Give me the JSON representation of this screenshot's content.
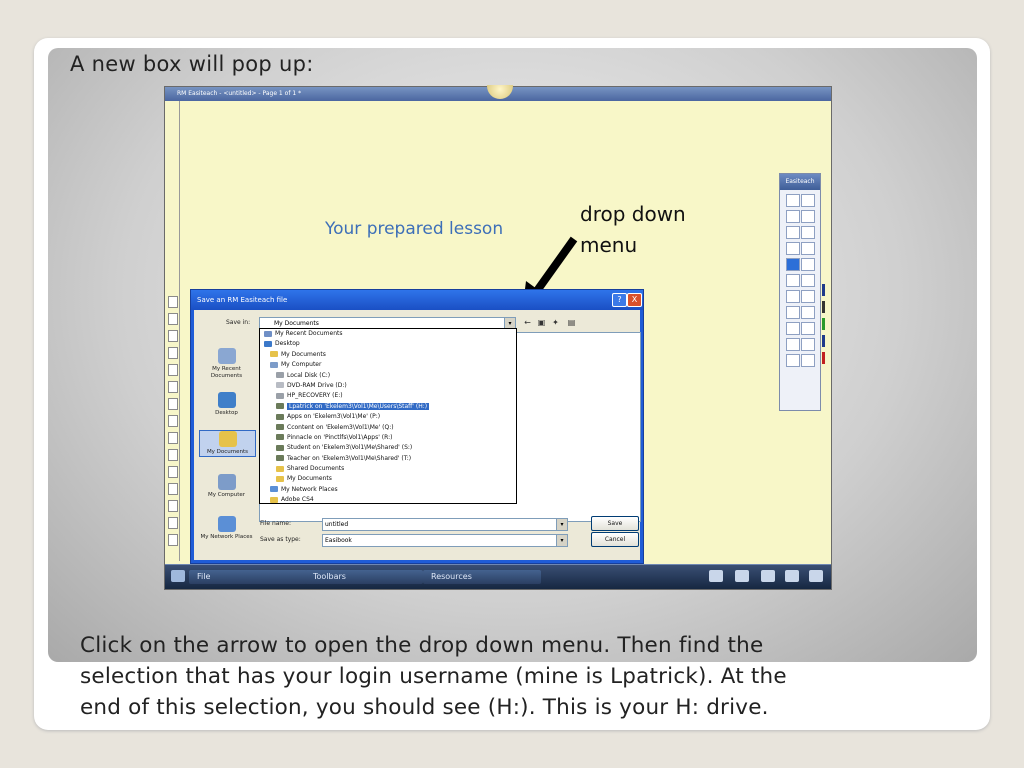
{
  "slide": {
    "title": "A new box will pop up:",
    "caption": [
      "Click on the arrow to open the drop down menu.  Then find the",
      "selection that has your login username (mine is Lpatrick).  At the",
      "end of this selection, you should see (H:).  This is your H: drive."
    ]
  },
  "app": {
    "window_title": "RM Easiteach - <untitled> - Page 1 of 1 *",
    "canvas_text": "Your prepared lesson",
    "annotation": [
      "drop down",
      "menu"
    ],
    "palette_title": "Easiteach",
    "taskbar": {
      "file": "File",
      "toolbars": "Toolbars",
      "resources": "Resources"
    }
  },
  "dialog": {
    "title": "Save an RM Easiteach file",
    "save_in_label": "Save in:",
    "save_in_value": "My Documents",
    "places": [
      "My Recent Documents",
      "Desktop",
      "My Documents",
      "My Computer",
      "My Network Places"
    ],
    "dropdown_items": [
      {
        "label": "My Recent Documents",
        "indent": 0,
        "color": "#6f8fc6"
      },
      {
        "label": "Desktop",
        "indent": 0,
        "color": "#3b78c9"
      },
      {
        "label": "My Documents",
        "indent": 1,
        "color": "#e6c24a"
      },
      {
        "label": "My Computer",
        "indent": 1,
        "color": "#7d9cc9"
      },
      {
        "label": "Local Disk (C:)",
        "indent": 2,
        "color": "#9aa0a8"
      },
      {
        "label": "DVD-RAM Drive (D:)",
        "indent": 2,
        "color": "#b8bcc4"
      },
      {
        "label": "HP_RECOVERY (E:)",
        "indent": 2,
        "color": "#9aa0a8"
      },
      {
        "label": "Lpatrick on 'Ekelem3\\Vol1\\Me\\Users\\Staff' (H:)",
        "indent": 2,
        "color": "#6b7b5a",
        "selected": true
      },
      {
        "label": "Apps on 'Ekelem3\\Vol1\\Me' (P:)",
        "indent": 2,
        "color": "#6b7b5a"
      },
      {
        "label": "Ccontent on 'Ekelem3\\Vol1\\Me' (Q:)",
        "indent": 2,
        "color": "#6b7b5a"
      },
      {
        "label": "Pinnacle on 'Pinctlfs\\Vol1\\Apps' (R:)",
        "indent": 2,
        "color": "#6b7b5a"
      },
      {
        "label": "Student on 'Ekelem3\\Vol1\\Me\\Shared' (S:)",
        "indent": 2,
        "color": "#6b7b5a"
      },
      {
        "label": "Teacher on 'Ekelem3\\Vol1\\Me\\Shared' (T:)",
        "indent": 2,
        "color": "#6b7b5a"
      },
      {
        "label": "Shared Documents",
        "indent": 2,
        "color": "#e6c24a"
      },
      {
        "label": "My Documents",
        "indent": 2,
        "color": "#e6c24a"
      },
      {
        "label": "My Network Places",
        "indent": 1,
        "color": "#5b8fd6"
      },
      {
        "label": "Adobe CS4",
        "indent": 1,
        "color": "#e6c24a"
      }
    ],
    "file_name_label": "File name:",
    "file_name_value": "untitled",
    "save_as_type_label": "Save as type:",
    "save_as_type_value": "Easibook",
    "save_button": "Save",
    "cancel_button": "Cancel",
    "close_glyph": "X",
    "help_glyph": "?"
  },
  "colors": {
    "accent": "#1f5cd7",
    "selection": "#316ac5",
    "canvas": "#f8f7c8"
  }
}
